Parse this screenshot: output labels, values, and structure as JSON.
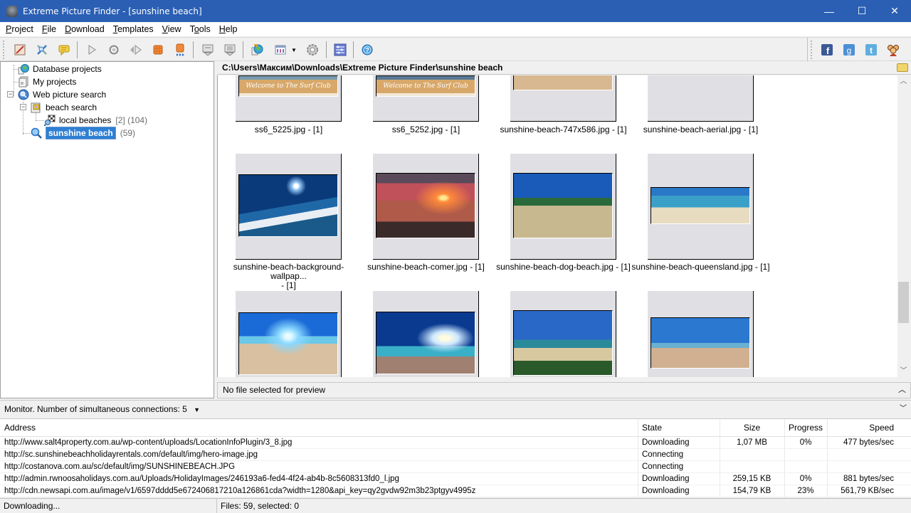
{
  "window": {
    "title": "Extreme Picture Finder - [sunshine beach]",
    "minimize": "—",
    "maximize": "☐",
    "close": "✕"
  },
  "menu": [
    {
      "label": "Project",
      "accel": "P",
      "rest": "roject"
    },
    {
      "label": "File",
      "accel": "F",
      "rest": "ile"
    },
    {
      "label": "Download",
      "accel": "D",
      "rest": "ownload"
    },
    {
      "label": "Templates",
      "accel": "T",
      "rest": "emplates"
    },
    {
      "label": "View",
      "accel": "V",
      "rest": "iew"
    },
    {
      "label": "Tools",
      "accel": "T",
      "pre": "T",
      "accel2": "o",
      "rest": "ols"
    },
    {
      "label": "Help",
      "accel": "H",
      "rest": "elp"
    }
  ],
  "toolbar": {
    "buttons": [
      "edit-project-icon",
      "search-settings-icon",
      "comment-icon",
      "start-icon",
      "refresh-icon",
      "step-icon",
      "stop-icon",
      "stop-all-icon",
      "download-selected-icon",
      "download-all-icon",
      "web-search-icon",
      "view-mode-icon",
      "view-dropdown-icon",
      "settings-icon",
      "queue-icon",
      "help-icon"
    ],
    "social": [
      "facebook-icon",
      "google-plus-icon",
      "twitter-icon",
      "community-icon"
    ]
  },
  "tree": {
    "items": [
      {
        "label": "Database projects",
        "count": ""
      },
      {
        "label": "My projects",
        "count": ""
      },
      {
        "label": "Web picture search",
        "count": ""
      },
      {
        "label": "beach search",
        "count": ""
      },
      {
        "label": "local beaches",
        "count": "[2] (104)"
      },
      {
        "label": "sunshine beach",
        "count": "(59)"
      }
    ]
  },
  "path": "C:\\Users\\Максим\\Downloads\\Extreme Picture Finder\\sunshine beach",
  "gallery": {
    "tiles": [
      {
        "caption": "ss6_5225.jpg - [1]"
      },
      {
        "caption": "ss6_5252.jpg - [1]"
      },
      {
        "caption": "sunshine-beach-747x586.jpg - [1]"
      },
      {
        "caption": "sunshine-beach-aerial.jpg - [1]"
      },
      {
        "caption": "sunshine-beach-background-wallpap...",
        "caption2": "- [1]"
      },
      {
        "caption": "sunshine-beach-comer.jpg - [1]"
      },
      {
        "caption": "sunshine-beach-dog-beach.jpg - [1]"
      },
      {
        "caption": "sunshine-beach-queensland.jpg - [1]"
      },
      {
        "caption": ""
      },
      {
        "caption": ""
      },
      {
        "caption": ""
      },
      {
        "caption": ""
      }
    ],
    "surf_sign_text": "Welcome to The Surf Club"
  },
  "preview": {
    "text": "No file selected for preview"
  },
  "monitor": {
    "label": "Monitor. Number of simultaneous connections: 5"
  },
  "downloads": {
    "columns": [
      "Address",
      "State",
      "Size",
      "Progress",
      "Speed"
    ],
    "rows": [
      {
        "address": "http://www.salt4property.com.au/wp-content/uploads/LocationInfoPlugin/3_8.jpg",
        "state": "Downloading",
        "size": "1,07 MB",
        "progress": "0%",
        "speed": "477 bytes/sec"
      },
      {
        "address": "http://sc.sunshinebeachholidayrentals.com/default/img/hero-image.jpg",
        "state": "Connecting",
        "size": "",
        "progress": "",
        "speed": ""
      },
      {
        "address": "http://costanova.com.au/sc/default/img/SUNSHINEBEACH.JPG",
        "state": "Connecting",
        "size": "",
        "progress": "",
        "speed": ""
      },
      {
        "address": "http://admin.rwnoosaholidays.com.au/Uploads/HolidayImages/246193a6-fed4-4f24-ab4b-8c5608313fd0_l.jpg",
        "state": "Downloading",
        "size": "259,15 KB",
        "progress": "0%",
        "speed": "881 bytes/sec"
      },
      {
        "address": "http://cdn.newsapi.com.au/image/v1/6597dddd5e672406817210a126861cda?width=1280&api_key=qy2gvdw92m3b23ptgyv4995z",
        "state": "Downloading",
        "size": "154,79 KB",
        "progress": "23%",
        "speed": "561,79 KB/sec"
      }
    ]
  },
  "status": {
    "left": "Downloading...",
    "right": "Files: 59, selected: 0"
  }
}
